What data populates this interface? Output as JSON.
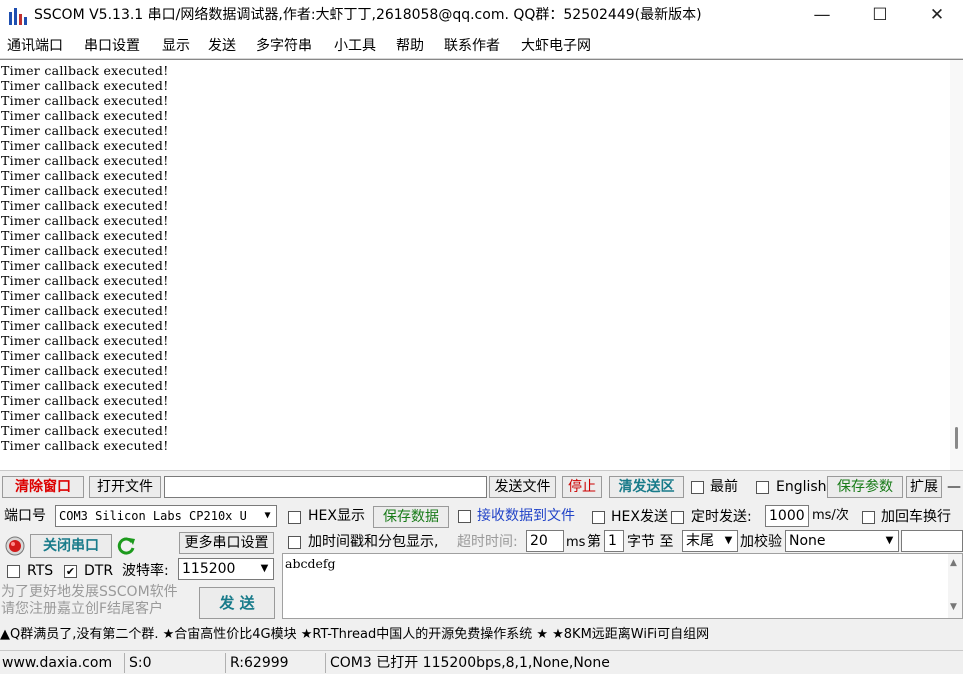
{
  "window": {
    "title": "SSCOM V5.13.1 串口/网络数据调试器,作者:大虾丁丁,2618058@qq.com. QQ群：52502449(最新版本)",
    "minimize": "—",
    "maximize": "☐",
    "close": "✕"
  },
  "menu": [
    "通讯端口",
    "串口设置",
    "显示",
    "发送",
    "多字符串",
    "小工具",
    "帮助",
    "联系作者",
    "大虾电子网"
  ],
  "receive": {
    "lines": [
      "Timer callback executed!",
      "Timer callback executed!",
      "Timer callback executed!",
      "Timer callback executed!",
      "Timer callback executed!",
      "Timer callback executed!",
      "Timer callback executed!",
      "Timer callback executed!",
      "Timer callback executed!",
      "Timer callback executed!",
      "Timer callback executed!",
      "Timer callback executed!",
      "Timer callback executed!",
      "Timer callback executed!",
      "Timer callback executed!",
      "Timer callback executed!",
      "Timer callback executed!",
      "Timer callback executed!",
      "Timer callback executed!",
      "Timer callback executed!",
      "Timer callback executed!",
      "Timer callback executed!",
      "Timer callback executed!",
      "Timer callback executed!",
      "Timer callback executed!",
      "Timer callback executed!"
    ]
  },
  "toolbar": {
    "clear_window": "清除窗口",
    "open_file": "打开文件",
    "file_path": "",
    "send_file": "发送文件",
    "stop": "停止",
    "clear_send": "清发送区",
    "topmost": "最前",
    "english": "English",
    "save_params": "保存参数",
    "expand": "扩展",
    "dash": "—"
  },
  "port": {
    "label": "端口号",
    "value": "COM3 Silicon Labs CP210x U",
    "close_port": "关闭串口",
    "more_settings": "更多串口设置",
    "rts": "RTS",
    "dtr": "DTR",
    "baud_label": "波特率:",
    "baud_value": "115200"
  },
  "options": {
    "hex_display": "HEX显示",
    "save_data": "保存数据",
    "recv_to_file": "接收数据到文件",
    "hex_send": "HEX发送",
    "timed_send": "定时发送:",
    "interval": "1000",
    "interval_unit": "ms/次",
    "add_crlf": "加回车换行",
    "timestamp": "加时间戳和分包显示,",
    "timeout_label": "超时时间:",
    "timeout_value": "20",
    "timeout_unit": "ms",
    "byte_prefix": "第",
    "byte_index": "1",
    "byte_suffix": "字节 至",
    "byte_end": "末尾",
    "checksum_label": "加校验",
    "checksum_value": "None"
  },
  "send": {
    "text": "abcdefg",
    "button": "发 送",
    "promo_line1": "为了更好地发展SSCOM软件",
    "promo_line2": "请您注册嘉立创F结尾客户"
  },
  "ticker": "▲Q群满员了,没有第二个群. ★合宙高性价比4G模块 ★RT-Thread中国人的开源免费操作系统 ★ ★8KM远距离WiFi可自组网",
  "status": {
    "website": "www.daxia.com",
    "sent": "S:0",
    "received": "R:62999",
    "port_state": "COM3 已打开  115200bps,8,1,None,None"
  }
}
